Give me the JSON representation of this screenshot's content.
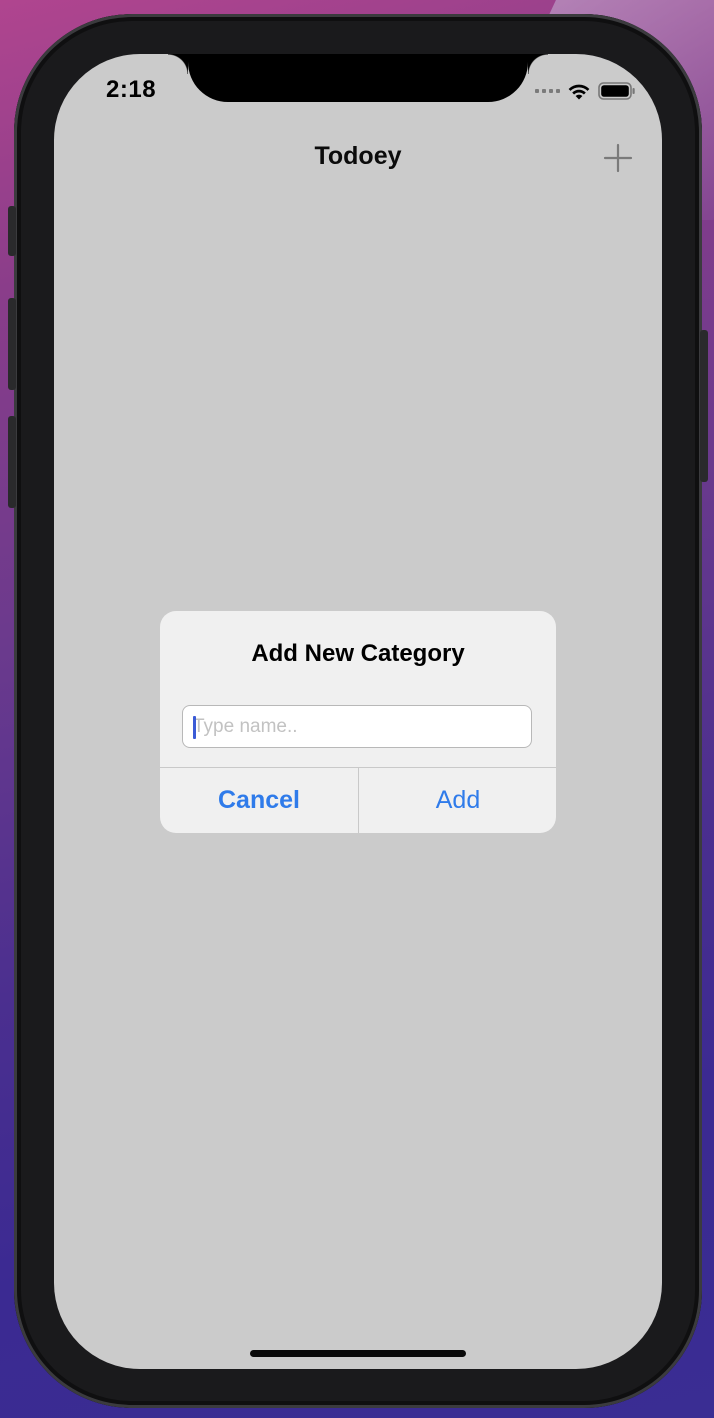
{
  "status_bar": {
    "time": "2:18"
  },
  "nav_bar": {
    "title": "Todoey",
    "add_icon": "plus-icon"
  },
  "alert": {
    "title": "Add New Category",
    "input": {
      "value": "",
      "placeholder": "Type name.."
    },
    "cancel_label": "Cancel",
    "add_label": "Add"
  },
  "colors": {
    "screen_background": "#cbcbcb",
    "alert_background": "#f0f0f0",
    "button_tint": "#2f7bea",
    "caret": "#3b5bd6"
  }
}
